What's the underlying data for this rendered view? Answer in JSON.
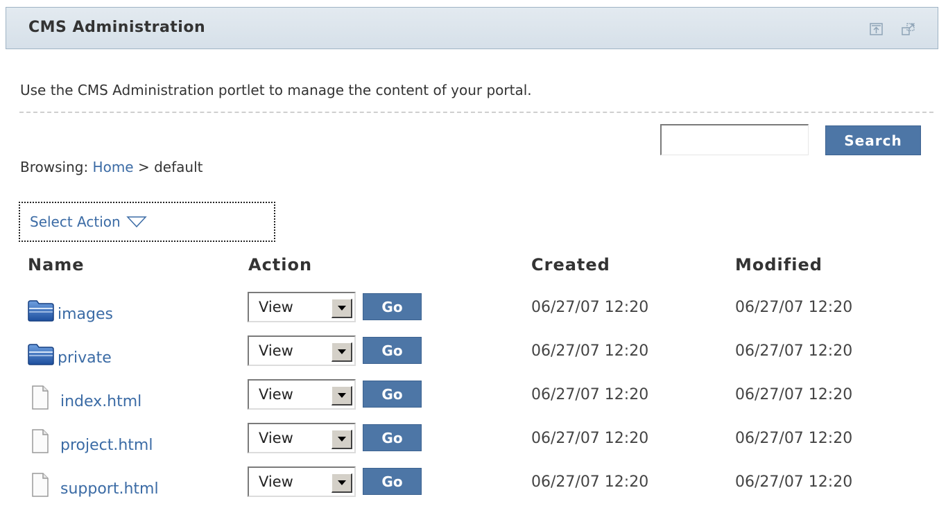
{
  "portlet": {
    "title": "CMS Administration",
    "description": "Use the CMS Administration portlet to manage the content of your portal."
  },
  "search": {
    "value": "",
    "button_label": "Search"
  },
  "breadcrumb": {
    "prefix": "Browsing: ",
    "home": "Home",
    "separator": " > ",
    "current": "default"
  },
  "select_action": {
    "label": "Select Action"
  },
  "table": {
    "headers": {
      "name": "Name",
      "action": "Action",
      "created": "Created",
      "modified": "Modified"
    },
    "rows": [
      {
        "type": "folder",
        "name": "images",
        "action": "View",
        "go": "Go",
        "created": "06/27/07 12:20",
        "modified": "06/27/07 12:20"
      },
      {
        "type": "folder",
        "name": "private",
        "action": "View",
        "go": "Go",
        "created": "06/27/07 12:20",
        "modified": "06/27/07 12:20"
      },
      {
        "type": "file",
        "name": "index.html",
        "action": "View",
        "go": "Go",
        "created": "06/27/07 12:20",
        "modified": "06/27/07 12:20"
      },
      {
        "type": "file",
        "name": "project.html",
        "action": "View",
        "go": "Go",
        "created": "06/27/07 12:20",
        "modified": "06/27/07 12:20"
      },
      {
        "type": "file",
        "name": "support.html",
        "action": "View",
        "go": "Go",
        "created": "06/27/07 12:20",
        "modified": "06/27/07 12:20"
      }
    ]
  },
  "icons": {
    "header_minimize": "minimize-icon",
    "header_maximize": "maximize-icon",
    "folder": "folder-icon",
    "file": "file-icon"
  },
  "colors": {
    "link": "#3b6ba5",
    "button": "#4d76a6",
    "header_bg": "#dce5ec"
  }
}
